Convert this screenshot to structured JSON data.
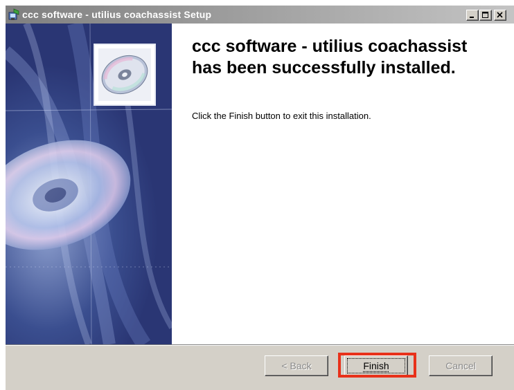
{
  "window": {
    "title": "ccc software - utilius coachassist Setup",
    "controls": [
      "minimize",
      "maximize",
      "close"
    ]
  },
  "main": {
    "heading": "ccc software - utilius coachassist has been successfully installed.",
    "message": "Click the Finish button to exit this installation."
  },
  "buttons": {
    "back": "< Back",
    "finish": "Finish",
    "cancel": "Cancel"
  },
  "colors": {
    "highlight": "#e8311a",
    "titlebar": "#808080",
    "panel": "#3a4e8f"
  }
}
